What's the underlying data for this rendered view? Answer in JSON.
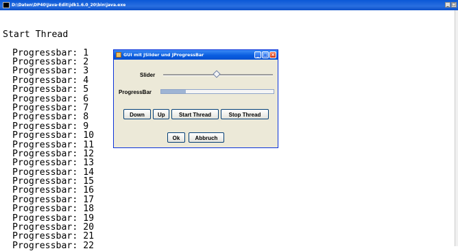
{
  "console": {
    "title": "D:\\Daten\\DP40\\Java-Edit\\jdk1.6.0_20\\bin\\java.exe",
    "first_line": "Start Thread",
    "lines": [
      "Progressbar: 1",
      "Progressbar: 2",
      "Progressbar: 3",
      "Progressbar: 4",
      "Progressbar: 5",
      "Progressbar: 6",
      "Progressbar: 7",
      "Progressbar: 8",
      "Progressbar: 9",
      "Progressbar: 10",
      "Progressbar: 11",
      "Progressbar: 12",
      "Progressbar: 13",
      "Progressbar: 14",
      "Progressbar: 15",
      "Progressbar: 16",
      "Progressbar: 17",
      "Progressbar: 18",
      "Progressbar: 19",
      "Progressbar: 20",
      "Progressbar: 21",
      "Progressbar: 22"
    ]
  },
  "dialog": {
    "title": "GUI mit JSlider und JProgressBar",
    "slider_label": "Slider",
    "progressbar_label": "ProgressBar",
    "slider_value_fraction": 0.49,
    "progress_fraction": 0.22,
    "buttons": {
      "down": "Down",
      "up": "Up",
      "start_thread": "Start Thread",
      "stop_thread": "Stop Thread",
      "ok": "Ok",
      "abbruch": "Abbruch"
    }
  },
  "colors": {
    "titlebar_blue": "#0a58d6",
    "dialog_bg": "#ece9d8",
    "progress_fill": "#9eb4d4"
  }
}
